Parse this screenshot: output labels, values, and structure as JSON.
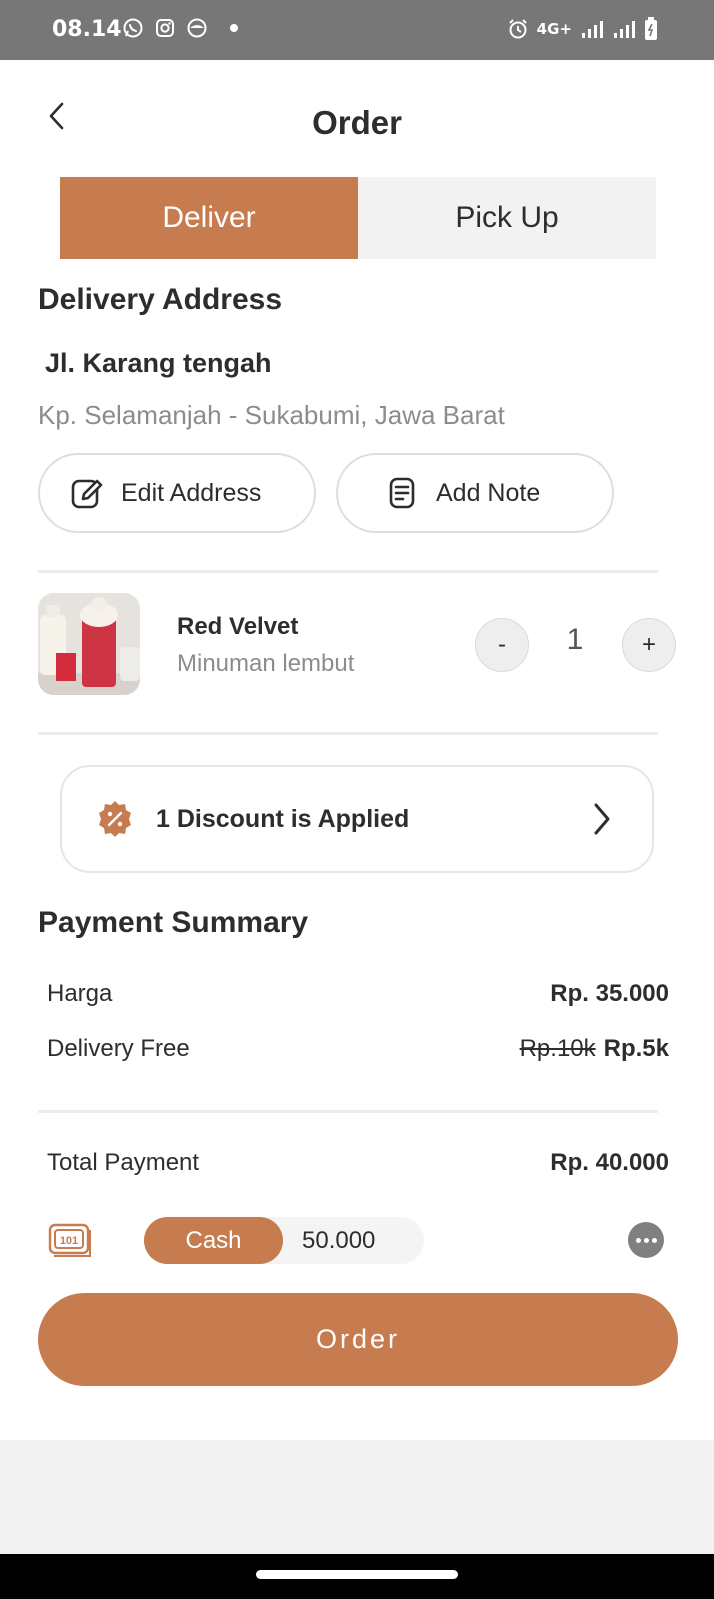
{
  "status_bar": {
    "time": "08.14",
    "network": "4G+"
  },
  "header": {
    "title": "Order"
  },
  "tabs": [
    {
      "label": "Deliver",
      "active": true
    },
    {
      "label": "Pick Up",
      "active": false
    }
  ],
  "delivery": {
    "section_title": "Delivery Address",
    "street": "Jl. Karang tengah",
    "detail": "Kp. Selamanjah - Sukabumi, Jawa Barat",
    "edit_label": "Edit Address",
    "note_label": "Add Note"
  },
  "item": {
    "name": "Red Velvet",
    "description": "Minuman lembut",
    "quantity": "1",
    "minus": "-",
    "plus": "+"
  },
  "discount": {
    "label": "1 Discount is Applied"
  },
  "summary": {
    "title": "Payment Summary",
    "price_label": "Harga",
    "price_value": "Rp. 35.000",
    "delivery_label": "Delivery Free",
    "delivery_old": "Rp.10k",
    "delivery_new": "Rp.5k",
    "total_label": "Total Payment",
    "total_value": "Rp. 40.000"
  },
  "payment": {
    "method": "Cash",
    "amount": "50.000"
  },
  "order_button": "Order",
  "colors": {
    "accent": "#c67c4e",
    "status_bar": "#777777",
    "muted_text": "#8c8c8c"
  }
}
